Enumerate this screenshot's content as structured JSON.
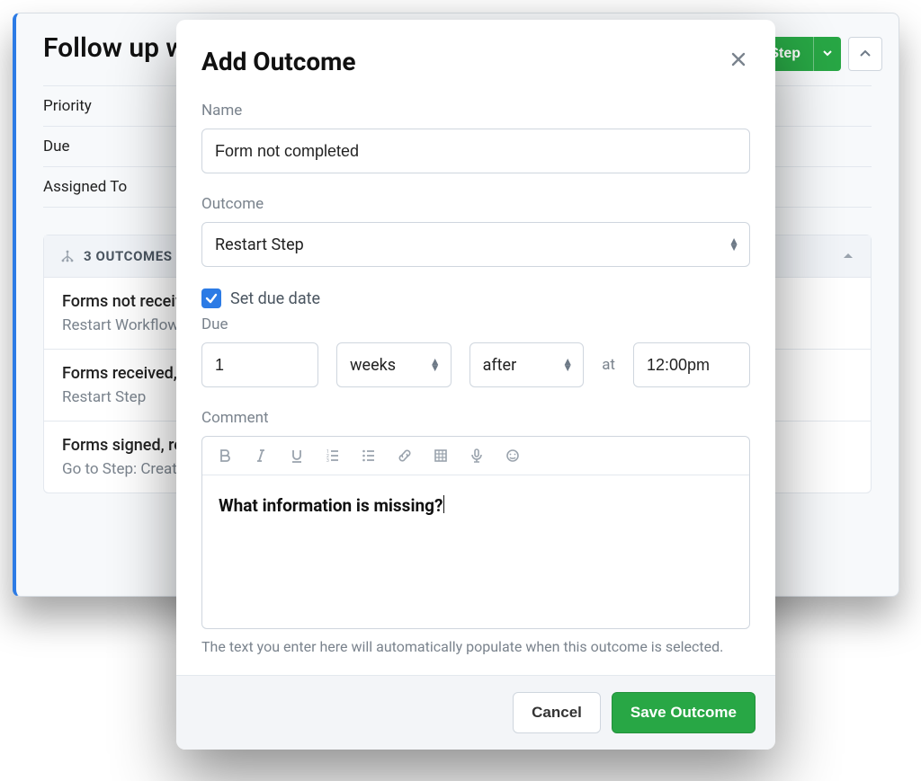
{
  "background": {
    "title": "Follow up with client to complete order forms",
    "fields": {
      "priority": "Priority",
      "due": "Due",
      "assigned_to": "Assigned To"
    },
    "header": {
      "step_button": "Step"
    },
    "outcomes": {
      "header": "3 OUTCOMES",
      "items": [
        {
          "title": "Forms not received",
          "sub": "Restart Workflow"
        },
        {
          "title": "Forms received, not complete",
          "sub": "Restart Step"
        },
        {
          "title": "Forms signed, ready to go",
          "sub": "Go to Step: Create order"
        }
      ]
    }
  },
  "modal": {
    "title": "Add Outcome",
    "name": {
      "label": "Name",
      "value": "Form not completed"
    },
    "outcome": {
      "label": "Outcome",
      "value": "Restart Step"
    },
    "due": {
      "checkbox_label": "Set due date",
      "checked": true,
      "label": "Due",
      "amount": "1",
      "unit": "weeks",
      "relation": "after",
      "at_label": "at",
      "time": "12:00pm"
    },
    "comment": {
      "label": "Comment",
      "content": "What information is missing?",
      "helper": "The text you enter here will automatically populate when this outcome is selected."
    },
    "footer": {
      "cancel": "Cancel",
      "save": "Save Outcome"
    }
  }
}
